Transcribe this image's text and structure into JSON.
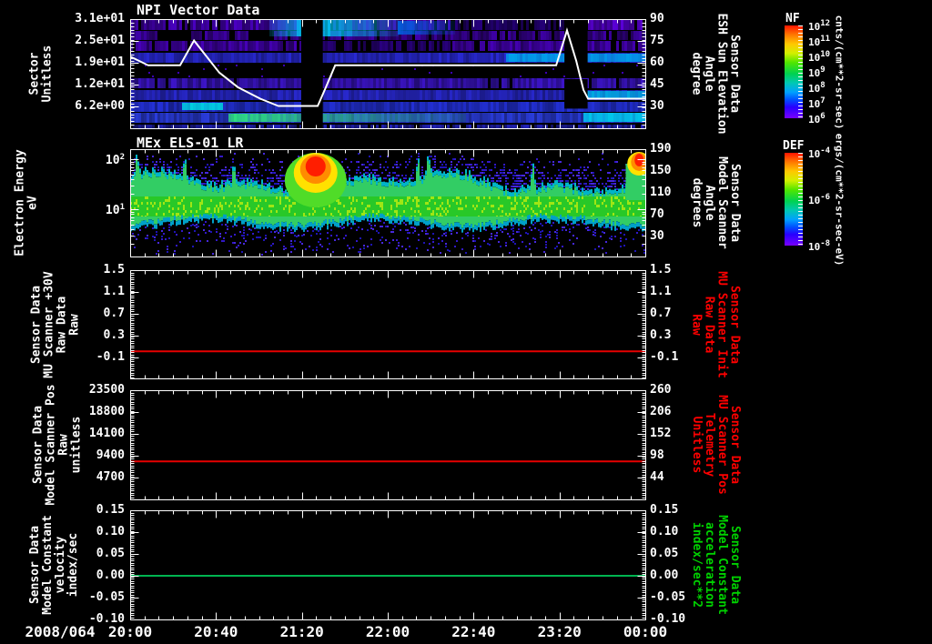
{
  "figure": {
    "background": "#000000",
    "date_label": "2008/064",
    "x_ticks": [
      "20:00",
      "20:40",
      "21:20",
      "22:00",
      "22:40",
      "23:20",
      "00:00"
    ]
  },
  "chart_data": [
    {
      "id": "npi-vector-data",
      "type": "heatmap",
      "title": "NPI Vector Data",
      "ylabel_left_lines": [
        "Sector",
        "Unitless"
      ],
      "yticks_left": [
        "3.1e+01",
        "2.5e+01",
        "1.9e+01",
        "1.2e+01",
        "6.2e+00"
      ],
      "ylabel_right_lines": [
        "Sensor Data",
        "ESH Sun Elevation",
        "Angle",
        "degree"
      ],
      "yticks_right": [
        "90",
        "75",
        "60",
        "45",
        "30"
      ],
      "colorbar": {
        "title": "NF",
        "ticks": [
          "10^12",
          "10^11",
          "10^10",
          "10^9",
          "10^8",
          "10^7",
          "10^6"
        ],
        "units": "cnts/(cm**2-sr-sec)"
      },
      "overlay_line": {
        "label": "ESH Sun Elevation Angle (degree)",
        "color": "#ffffff",
        "points": [
          [
            0,
            63
          ],
          [
            0.035,
            57
          ],
          [
            0.097,
            57
          ],
          [
            0.124,
            74
          ],
          [
            0.173,
            52
          ],
          [
            0.209,
            42
          ],
          [
            0.253,
            34
          ],
          [
            0.288,
            29
          ],
          [
            0.364,
            29
          ],
          [
            0.38,
            42
          ],
          [
            0.398,
            57
          ],
          [
            0.827,
            57
          ],
          [
            0.848,
            81
          ],
          [
            0.866,
            60
          ],
          [
            0.88,
            40
          ],
          [
            0.889,
            34
          ],
          [
            1,
            34
          ]
        ]
      },
      "data_gaps": [
        [
          0.332,
          0.374,
          0,
          1
        ],
        [
          0.843,
          0.888,
          0,
          0.48
        ],
        [
          0.843,
          0.888,
          0.55,
          0.82
        ]
      ],
      "bands": [
        {
          "x": [
            0,
            0.33
          ],
          "y": [
            1,
            12
          ],
          "color": "#4a00c3",
          "noise": 0.5,
          "skip": 0.1
        },
        {
          "x": [
            0.373,
            0.62
          ],
          "y": [
            1,
            12
          ],
          "color": "#4a00c3",
          "noise": 0.5,
          "skip": 0.1
        },
        {
          "x": [
            0.62,
            0.843
          ],
          "y": [
            1,
            12
          ],
          "color": "#26007d",
          "noise": 0.5,
          "skip": 0.2
        },
        {
          "x": [
            0.888,
            1
          ],
          "y": [
            1,
            12
          ],
          "color": "#5a00d7",
          "noise": 0.4,
          "skip": 0.08
        },
        {
          "x": [
            0,
            0.05
          ],
          "y": [
            13,
            23
          ],
          "color": "#3f00aa",
          "noise": 0.5,
          "skip": 0.1
        },
        {
          "x": [
            0.118,
            0.23
          ],
          "y": [
            13,
            23
          ],
          "color": "#3f00aa",
          "noise": 0.5,
          "skip": 0.15
        },
        {
          "x": [
            0.28,
            0.33
          ],
          "y": [
            13,
            23
          ],
          "color": "#3f00aa",
          "noise": 0.5,
          "skip": 0.15
        },
        {
          "x": [
            0.373,
            1
          ],
          "y": [
            13,
            23
          ],
          "color": "#3f00aa",
          "noise": 0.55,
          "skip": 0.25
        },
        {
          "x": [
            0.27,
            0.335
          ],
          "y": [
            0,
            19
          ],
          "color": "#00c8f5",
          "noise": 0.3,
          "fade": "left"
        },
        {
          "x": [
            0.373,
            0.52
          ],
          "y": [
            0,
            19
          ],
          "color": "#00c8f5",
          "noise": 0.3,
          "fade": "right"
        },
        {
          "x": [
            0.52,
            0.63
          ],
          "y": [
            2,
            17
          ],
          "color": "#0064e1",
          "noise": 0.3,
          "fade": "right"
        },
        {
          "x": [
            0,
            0.33
          ],
          "y": [
            24,
            35
          ],
          "color": "#4600b9",
          "noise": 0.5,
          "skip": 0.12
        },
        {
          "x": [
            0.373,
            0.62
          ],
          "y": [
            24,
            35
          ],
          "color": "#2a0082",
          "noise": 0.4,
          "skip": 0.3
        },
        {
          "x": [
            0.62,
            1
          ],
          "y": [
            24,
            35
          ],
          "color": "#4600b9",
          "noise": 0.5,
          "skip": 0.12
        },
        {
          "x": [
            0,
            1
          ],
          "y": [
            37,
            48
          ],
          "color": "#2828d2",
          "noise": 0.35
        },
        {
          "x": [
            0.73,
            1
          ],
          "y": [
            38,
            47
          ],
          "color": "#00a0eb",
          "noise": 0.3
        },
        {
          "x": [
            0,
            1
          ],
          "y": [
            50,
            64
          ],
          "color": "#3c00b4",
          "noise": 0.05,
          "dots": true
        },
        {
          "x": [
            0,
            1
          ],
          "y": [
            65,
            76
          ],
          "color": "#3c14c8",
          "noise": 0.45,
          "skip": 0.06
        },
        {
          "x": [
            0,
            1
          ],
          "y": [
            78,
            89
          ],
          "color": "#2828cd",
          "noise": 0.35
        },
        {
          "x": [
            0.88,
            1
          ],
          "y": [
            79,
            88
          ],
          "color": "#00aae1",
          "noise": 0.3
        },
        {
          "x": [
            0,
            1
          ],
          "y": [
            91,
            102
          ],
          "color": "#2330d7",
          "noise": 0.35
        },
        {
          "x": [
            0.1,
            0.18
          ],
          "y": [
            92,
            100
          ],
          "color": "#00d2e1",
          "noise": 0.25
        },
        {
          "x": [
            0,
            1
          ],
          "y": [
            103,
            114
          ],
          "color": "#2a3cdc",
          "noise": 0.35
        },
        {
          "x": [
            0.19,
            0.65
          ],
          "y": [
            104,
            113
          ],
          "color": "#2ee67d",
          "noise": 0.3,
          "fade": "right"
        },
        {
          "x": [
            0.88,
            1
          ],
          "y": [
            103,
            113
          ],
          "color": "#00c8eb",
          "noise": 0.25
        },
        {
          "x": [
            0,
            1
          ],
          "y": [
            116,
            120
          ],
          "color": "#2222b9",
          "noise": 0.5,
          "skip": 0.2
        }
      ]
    },
    {
      "id": "mex-els-01-lr",
      "type": "heatmap",
      "title": "MEx ELS-01 LR",
      "ylabel_left_lines": [
        "Electron Energy",
        "eV"
      ],
      "yticks_left": [
        "10^2",
        "10^1"
      ],
      "ylabel_right_lines": [
        "Sensor Data",
        "Model Scanner",
        "Angle",
        "degrees"
      ],
      "yticks_right": [
        "190",
        "150",
        "110",
        "70",
        "30"
      ],
      "colorbar": {
        "title": "DEF",
        "ticks": [
          "10^-4",
          "10^-6",
          "10^-8"
        ],
        "units": "ergs/(cm**2-sr-sec-eV)"
      },
      "main_band": {
        "energy_eV": [
          6,
          40
        ],
        "core_color": "#28c828",
        "bright_color": "#a0e614",
        "mid_color": "#32cd64",
        "edge_color": "#00b4c8",
        "lower_edge_color": "#00a0c8"
      },
      "hot_spot": {
        "time_frac": 0.36,
        "layers": [
          [
            34,
            30,
            34,
            "#50dc28"
          ],
          [
            24,
            22,
            26,
            "#ffe100"
          ],
          [
            17,
            16,
            22,
            "#ff8c00"
          ],
          [
            11,
            11,
            19,
            "#ff1e00"
          ]
        ]
      },
      "right_hot_spot": {
        "time_frac": 0.988,
        "layers": [
          [
            13,
            13,
            16,
            "#ffe100"
          ],
          [
            9,
            10,
            14,
            "#ff8c00"
          ],
          [
            5,
            7,
            12,
            "#ff1e00"
          ]
        ]
      },
      "spikes_time_frac": [
        0.012,
        0.105,
        0.2,
        0.31,
        0.557,
        0.578,
        0.78
      ],
      "speckle_colors": [
        "#1e14b4",
        "#3218c8",
        "#4628dc"
      ]
    },
    {
      "id": "mu-scanner-plus30v",
      "type": "line",
      "ylabel_left_lines": [
        "Sensor Data",
        "MU Scanner +30V",
        "Raw Data",
        "Raw"
      ],
      "yticks_left": [
        "1.5",
        "1.1",
        "0.7",
        "0.3",
        "-0.1"
      ],
      "ylabel_right_lines": [
        "Sensor Data",
        "MU Scanner Init",
        "Raw Data",
        "Raw"
      ],
      "yticks_right": [
        "1.5",
        "1.1",
        "0.7",
        "0.3",
        "-0.1"
      ],
      "right_label_color": "#ff0000",
      "ylim": [
        -0.5,
        1.5
      ],
      "series": [
        {
          "name": "MU Scanner +30V Raw",
          "color": "#e60000",
          "value": 0.0
        }
      ]
    },
    {
      "id": "model-scanner-pos",
      "type": "line",
      "ylabel_left_lines": [
        "Sensor Data",
        "Model Scanner Pos",
        "Raw",
        "unitless"
      ],
      "yticks_left": [
        "23500",
        "18800",
        "14100",
        "9400",
        "4700"
      ],
      "ylabel_right_lines": [
        "Sensor Data",
        "MU Scanner Pos",
        "Telemetry",
        "Unitless"
      ],
      "yticks_right": [
        "260",
        "206",
        "152",
        "98",
        "44"
      ],
      "right_label_color": "#ff0000",
      "ylim": [
        0,
        23500
      ],
      "series": [
        {
          "name": "Model Scanner Pos Raw",
          "color": "#e60000",
          "value": 8200,
          "value_right_axis": 85
        }
      ]
    },
    {
      "id": "model-constant",
      "type": "line",
      "ylabel_left_lines": [
        "Sensor Data",
        "Model Constant",
        "velocity",
        "index/sec"
      ],
      "yticks_left": [
        "0.15",
        "0.10",
        "0.05",
        "0.00",
        "-0.05",
        "-0.10"
      ],
      "ylabel_right_lines": [
        "Sensor Data",
        "Model Constant",
        "acceleration",
        "index/sec**2"
      ],
      "yticks_right": [
        "0.15",
        "0.10",
        "0.05",
        "0.00",
        "-0.05",
        "-0.10"
      ],
      "right_label_color": "#00d200",
      "ylim": [
        -0.1,
        0.15
      ],
      "series": [
        {
          "name": "Model Constant velocity",
          "color": "#00b450",
          "value": 0.0
        }
      ]
    }
  ]
}
